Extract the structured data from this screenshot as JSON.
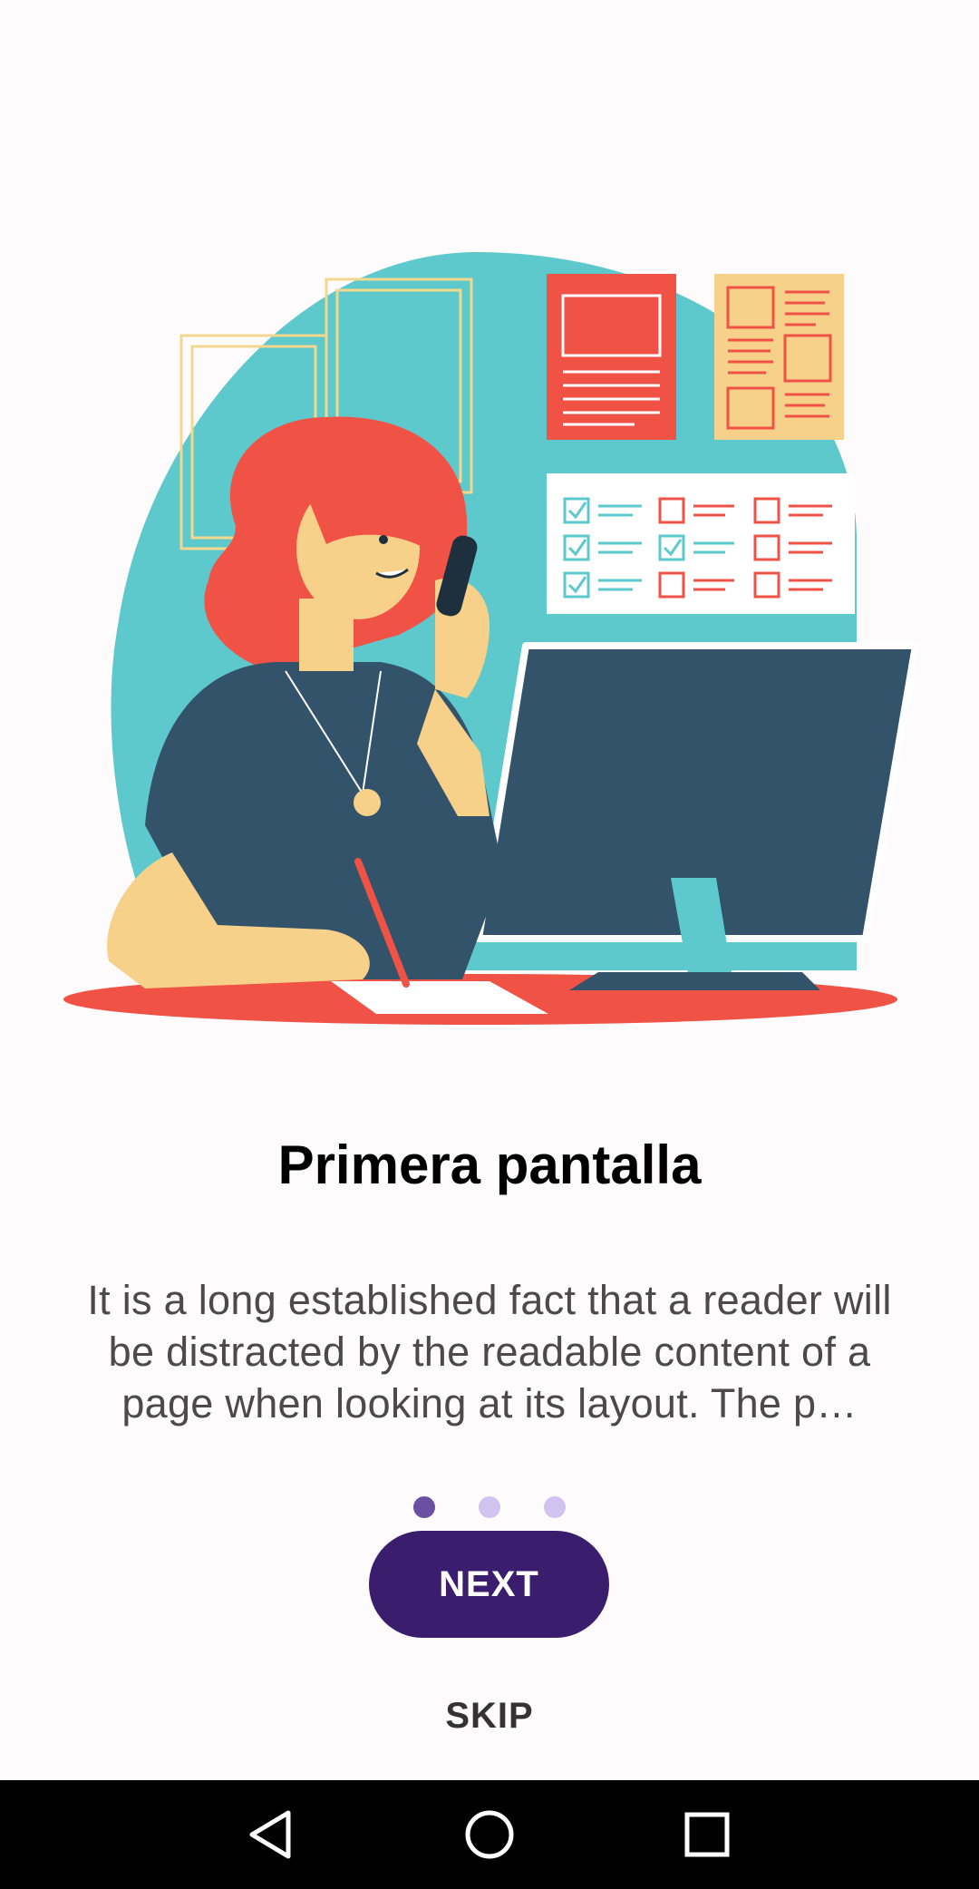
{
  "onboarding": {
    "title": "Primera pantalla",
    "description": "It is a long established fact that a reader will be distracted by the readable content of a page when looking at its layout. The p…",
    "page_indicator": {
      "current": 1,
      "total": 3
    },
    "next_label": "NEXT",
    "skip_label": "SKIP"
  },
  "illustration": {
    "subject": "woman-on-phone-at-desk-with-computer"
  },
  "navigation_bar": {
    "buttons": [
      "back",
      "home",
      "recents"
    ]
  },
  "colors": {
    "background": "#fefbfd",
    "accent": "#3b1d6e",
    "dot_active": "#6a4fa3",
    "dot_inactive": "#d2c2ef",
    "teal": "#5ec9cc",
    "coral": "#f05245",
    "navy": "#33536b",
    "skin": "#f7d08a"
  }
}
